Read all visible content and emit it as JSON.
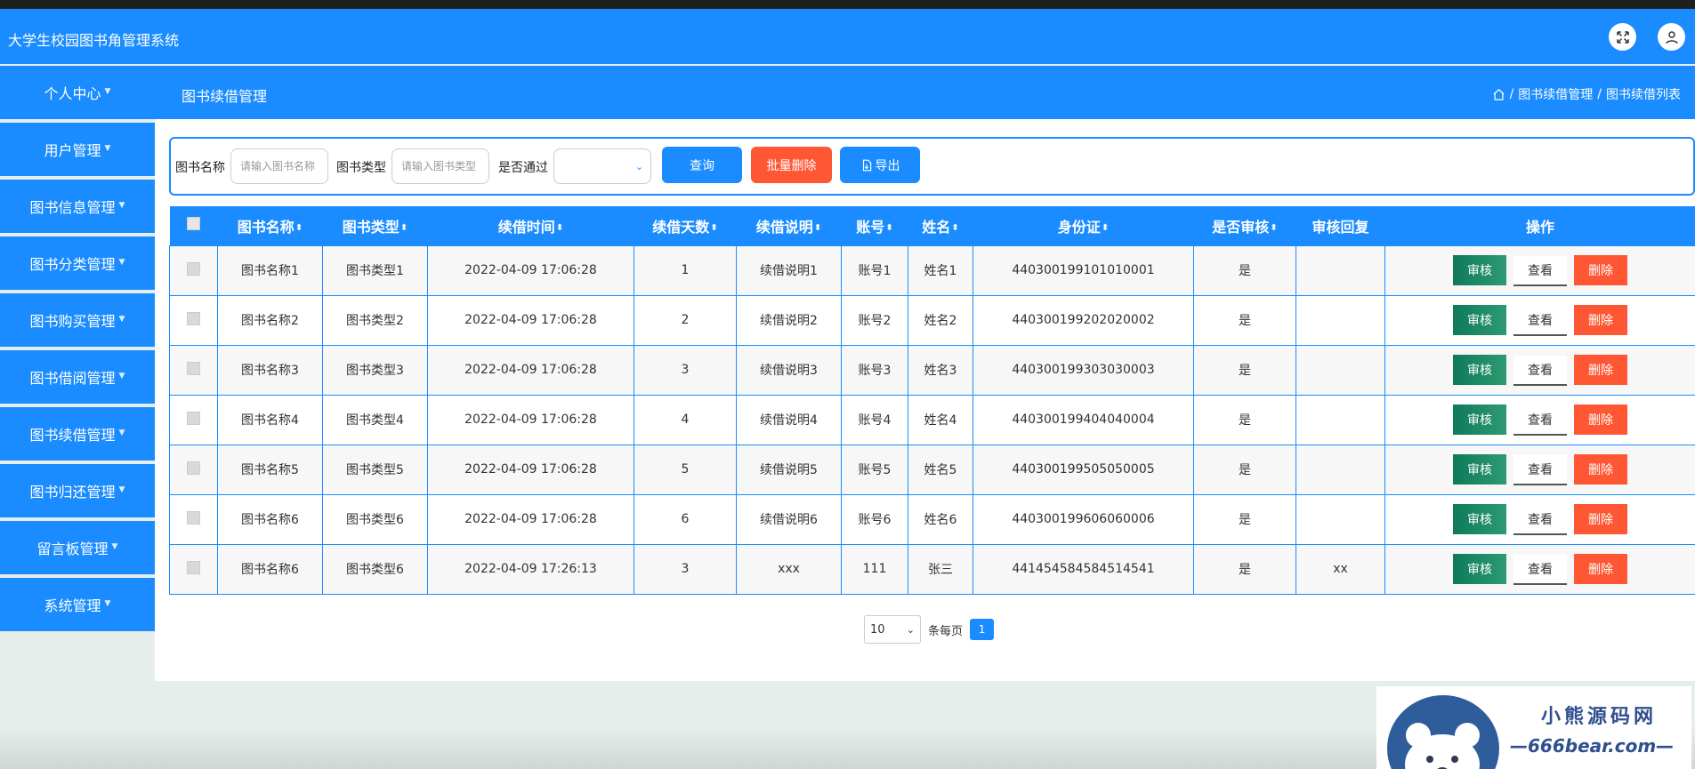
{
  "app": {
    "title": "大学生校园图书角管理系统"
  },
  "sidebar": {
    "items": [
      {
        "label": "个人中心"
      },
      {
        "label": "用户管理"
      },
      {
        "label": "图书信息管理"
      },
      {
        "label": "图书分类管理"
      },
      {
        "label": "图书购买管理"
      },
      {
        "label": "图书借阅管理"
      },
      {
        "label": "图书续借管理"
      },
      {
        "label": "图书归还管理"
      },
      {
        "label": "留言板管理"
      },
      {
        "label": "系统管理"
      }
    ]
  },
  "header": {
    "title": "图书续借管理",
    "breadcrumb": [
      "/",
      "图书续借管理",
      "/",
      "图书续借列表"
    ]
  },
  "search": {
    "name_label": "图书名称",
    "name_placeholder": "请输入图书名称",
    "type_label": "图书类型",
    "type_placeholder": "请输入图书类型",
    "pass_label": "是否通过",
    "pass_value": "",
    "query_button": "查询",
    "batch_delete_button": "批量删除",
    "export_button": "导出"
  },
  "table": {
    "columns": [
      "图书名称",
      "图书类型",
      "续借时间",
      "续借天数",
      "续借说明",
      "账号",
      "姓名",
      "身份证",
      "是否审核",
      "审核回复",
      "操作"
    ],
    "rows": [
      {
        "name": "图书名称1",
        "type": "图书类型1",
        "time": "2022-04-09 17:06:28",
        "days": "1",
        "desc": "续借说明1",
        "account": "账号1",
        "person": "姓名1",
        "idcard": "440300199101010001",
        "audit": "是",
        "reply": ""
      },
      {
        "name": "图书名称2",
        "type": "图书类型2",
        "time": "2022-04-09 17:06:28",
        "days": "2",
        "desc": "续借说明2",
        "account": "账号2",
        "person": "姓名2",
        "idcard": "440300199202020002",
        "audit": "是",
        "reply": ""
      },
      {
        "name": "图书名称3",
        "type": "图书类型3",
        "time": "2022-04-09 17:06:28",
        "days": "3",
        "desc": "续借说明3",
        "account": "账号3",
        "person": "姓名3",
        "idcard": "440300199303030003",
        "audit": "是",
        "reply": ""
      },
      {
        "name": "图书名称4",
        "type": "图书类型4",
        "time": "2022-04-09 17:06:28",
        "days": "4",
        "desc": "续借说明4",
        "account": "账号4",
        "person": "姓名4",
        "idcard": "440300199404040004",
        "audit": "是",
        "reply": ""
      },
      {
        "name": "图书名称5",
        "type": "图书类型5",
        "time": "2022-04-09 17:06:28",
        "days": "5",
        "desc": "续借说明5",
        "account": "账号5",
        "person": "姓名5",
        "idcard": "440300199505050005",
        "audit": "是",
        "reply": ""
      },
      {
        "name": "图书名称6",
        "type": "图书类型6",
        "time": "2022-04-09 17:06:28",
        "days": "6",
        "desc": "续借说明6",
        "account": "账号6",
        "person": "姓名6",
        "idcard": "440300199606060006",
        "audit": "是",
        "reply": ""
      },
      {
        "name": "图书名称6",
        "type": "图书类型6",
        "time": "2022-04-09 17:26:13",
        "days": "3",
        "desc": "xxx",
        "account": "111",
        "person": "张三",
        "idcard": "441454584584514541",
        "audit": "是",
        "reply": "xx"
      }
    ],
    "actions": {
      "audit": "审核",
      "view": "查看",
      "delete": "删除"
    }
  },
  "pagination": {
    "page_size": "10",
    "per_page_label": "条每页",
    "current_page": "1"
  },
  "watermark": {
    "title": "小熊源码网",
    "subtitle": "—666bear.com—"
  },
  "colors": {
    "primary": "#1a8cff",
    "danger": "#ff5733",
    "audit": "#0f7a5a"
  }
}
